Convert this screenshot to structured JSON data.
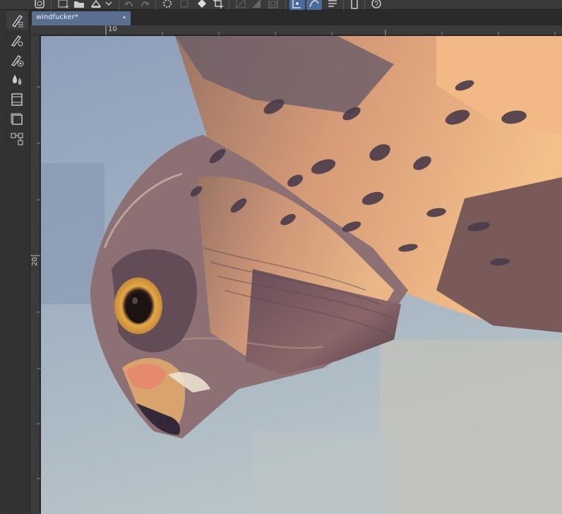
{
  "document": {
    "tab_title": "windfucker*",
    "tab_close_symbol": "•"
  },
  "rulers": {
    "top_label": "10",
    "left_label": "20"
  },
  "toolbar": {
    "icons": [
      "app-menu-icon",
      "new-layer-icon",
      "open-folder-icon",
      "save-icon",
      "undo-icon",
      "redo-icon",
      "loading-spinner-icon",
      "transform-icon",
      "fill-icon",
      "crop-icon",
      "clear-icon",
      "fill-selection-icon",
      "border-icon",
      "stabilizer-icon",
      "vector-icon",
      "ruler-icon",
      "smartphone-icon",
      "help-icon"
    ]
  },
  "sub_tools": {
    "icons": [
      "brush-sub-tool-icon",
      "brush-settings-icon",
      "brush-target-icon",
      "water-drops-icon",
      "film-icon",
      "layers-icon",
      "nodes-icon"
    ]
  },
  "colors": {
    "active_tab": "#5a6f8f",
    "ui_dark": "#2b2b2b",
    "ruler": "#3b3b3b"
  }
}
